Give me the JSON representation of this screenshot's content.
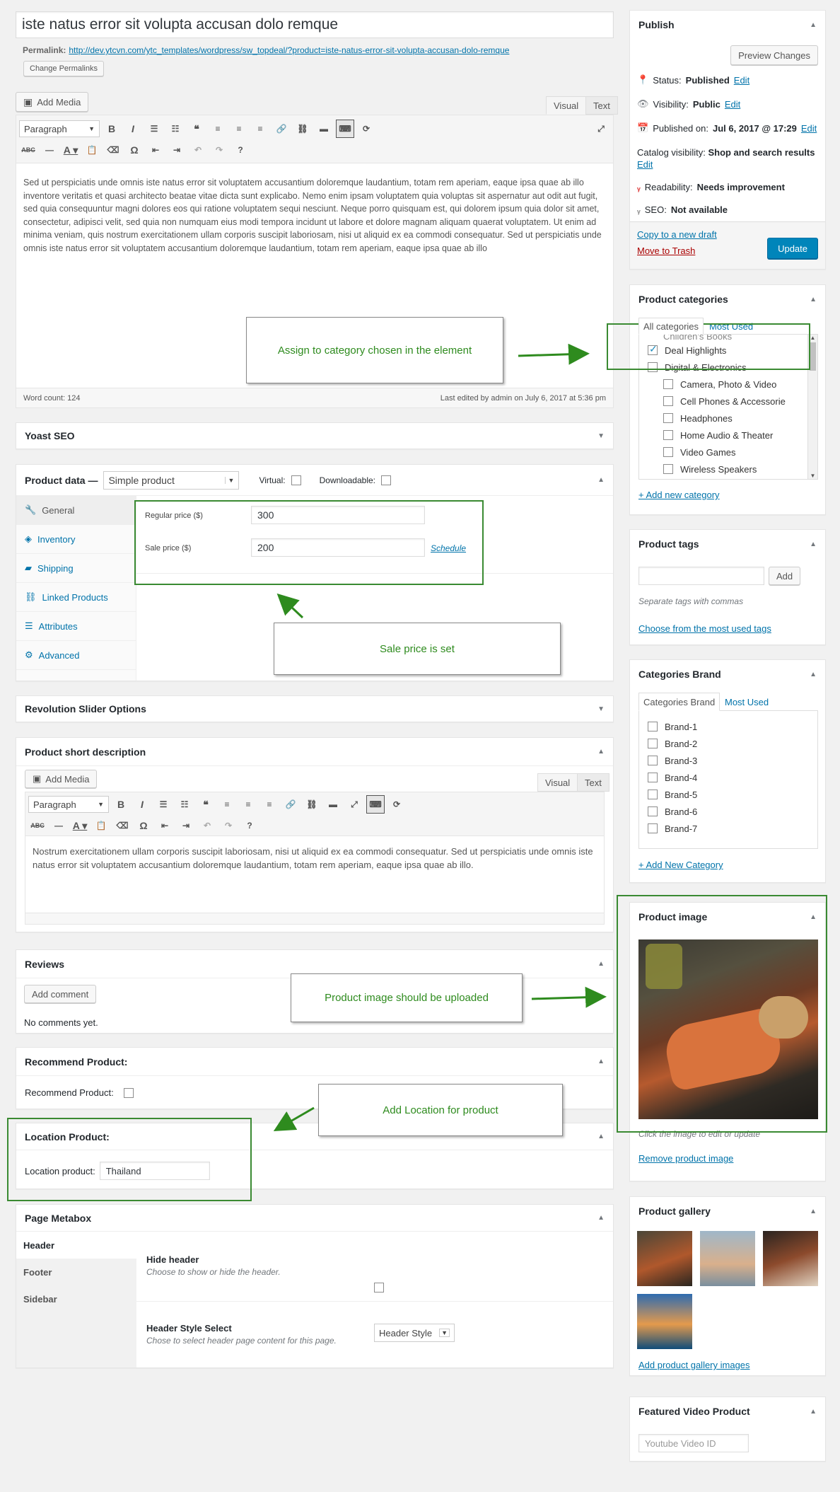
{
  "post": {
    "title": "iste natus error sit volupta accusan dolo remque",
    "permalink_label": "Permalink:",
    "permalink_url": "http://dev.ytcvn.com/ytc_templates/wordpress/sw_topdeal/?product=iste-natus-error-sit-volupta-accusan-dolo-remque",
    "change_permalinks": "Change Permalinks",
    "add_media": "Add Media",
    "tab_visual": "Visual",
    "tab_text": "Text",
    "format": "Paragraph",
    "content": "Sed ut perspiciatis unde omnis iste natus error sit voluptatem accusantium doloremque laudantium, totam rem aperiam, eaque ipsa quae ab illo inventore veritatis et quasi architecto beatae vitae dicta sunt explicabo. Nemo enim ipsam voluptatem quia voluptas sit aspernatur aut odit aut fugit, sed quia consequuntur magni dolores eos qui ratione voluptatem sequi nesciunt. Neque porro quisquam est, qui dolorem ipsum quia dolor sit amet, consectetur, adipisci velit, sed quia non numquam eius modi tempora incidunt ut labore et dolore magnam aliquam quaerat voluptatem. Ut enim ad minima veniam, quis nostrum exercitationem ullam corporis suscipit laboriosam, nisi ut aliquid ex ea commodi consequatur. Sed ut perspiciatis unde omnis iste natus error sit voluptatem accusantium doloremque laudantium, totam rem aperiam, eaque ipsa quae ab illo",
    "word_count": "Word count: 124",
    "last_edited": "Last edited by admin on July 6, 2017 at 5:36 pm"
  },
  "yoast": {
    "title": "Yoast SEO"
  },
  "product_data": {
    "title": "Product data —",
    "type": "Simple product",
    "virtual": "Virtual:",
    "downloadable": "Downloadable:",
    "tabs": [
      {
        "label": "General",
        "icon": "wrench-icon"
      },
      {
        "label": "Inventory",
        "icon": "tag-icon"
      },
      {
        "label": "Shipping",
        "icon": "truck-icon"
      },
      {
        "label": "Linked Products",
        "icon": "link-icon"
      },
      {
        "label": "Attributes",
        "icon": "list-icon"
      },
      {
        "label": "Advanced",
        "icon": "gear-icon"
      }
    ],
    "regular_price_label": "Regular price ($)",
    "regular_price": "300",
    "sale_price_label": "Sale price ($)",
    "sale_price": "200",
    "schedule": "Schedule"
  },
  "rev_slider": {
    "title": "Revolution Slider Options"
  },
  "short_desc": {
    "title": "Product short description",
    "add_media": "Add Media",
    "tab_visual": "Visual",
    "tab_text": "Text",
    "format": "Paragraph",
    "content": "Nostrum exercitationem ullam corporis suscipit laboriosam, nisi ut aliquid ex ea commodi consequatur. Sed ut perspiciatis unde omnis iste natus error sit voluptatem accusantium doloremque laudantium, totam rem aperiam, eaque ipsa quae ab illo."
  },
  "reviews": {
    "title": "Reviews",
    "add_comment": "Add comment",
    "none": "No comments yet."
  },
  "recommend": {
    "title": "Recommend Product:",
    "label": "Recommend Product:"
  },
  "location": {
    "title": "Location Product:",
    "label": "Location product:",
    "value": "Thailand"
  },
  "page_metabox": {
    "title": "Page Metabox",
    "tabs": [
      "Header",
      "Footer",
      "Sidebar"
    ],
    "hide_header_label": "Hide header",
    "hide_header_desc": "Choose to show or hide the header.",
    "header_style_label": "Header Style Select",
    "header_style_desc": "Chose to select header page content for this page.",
    "header_style_value": "Header Style"
  },
  "publish": {
    "title": "Publish",
    "preview": "Preview Changes",
    "status_label": "Status:",
    "status_value": "Published",
    "visibility_label": "Visibility:",
    "visibility_value": "Public",
    "published_on_label": "Published on:",
    "published_on_value": "Jul 6, 2017 @ 17:29",
    "catalog_label": "Catalog visibility:",
    "catalog_value": "Shop and search results",
    "readability_label": "Readability:",
    "readability_value": "Needs improvement",
    "seo_label": "SEO:",
    "seo_value": "Not available",
    "edit": "Edit",
    "copy_draft": "Copy to a new draft",
    "trash": "Move to Trash",
    "update": "Update"
  },
  "categories": {
    "title": "Product categories",
    "tab_all": "All categories",
    "tab_used": "Most Used",
    "partial": "Children's Books",
    "items": [
      {
        "label": "Deal Highlights",
        "checked": true,
        "indent": 0
      },
      {
        "label": "Digital & Electronics",
        "checked": false,
        "indent": 0
      },
      {
        "label": "Camera, Photo & Video",
        "checked": false,
        "indent": 1
      },
      {
        "label": "Cell Phones & Accessorie",
        "checked": false,
        "indent": 1
      },
      {
        "label": "Headphones",
        "checked": false,
        "indent": 1
      },
      {
        "label": "Home Audio & Theater",
        "checked": false,
        "indent": 1
      },
      {
        "label": "Video Games",
        "checked": false,
        "indent": 1
      },
      {
        "label": "Wireless Speakers",
        "checked": false,
        "indent": 1
      }
    ],
    "add_new": "+ Add new category"
  },
  "tags": {
    "title": "Product tags",
    "add": "Add",
    "hint": "Separate tags with commas",
    "choose": "Choose from the most used tags"
  },
  "brands": {
    "title": "Categories Brand",
    "tab_all": "Categories Brand",
    "tab_used": "Most Used",
    "items": [
      "Brand-1",
      "Brand-2",
      "Brand-3",
      "Brand-4",
      "Brand-5",
      "Brand-6",
      "Brand-7"
    ],
    "add_new": "+ Add New Category"
  },
  "product_image": {
    "title": "Product image",
    "hint": "Click the image to edit or update",
    "remove": "Remove product image"
  },
  "gallery": {
    "title": "Product gallery",
    "add": "Add product gallery images"
  },
  "video": {
    "title": "Featured Video Product",
    "placeholder": "Youtube Video ID"
  },
  "annotations": {
    "category": "Assign to category chosen in the element",
    "sale": "Sale price is set",
    "image": "Product image should be uploaded",
    "location": "Add Location for product"
  },
  "colors": {
    "accent": "#0073aa",
    "annotation": "#3a8a32",
    "primary_button": "#0085ba",
    "trash": "#a00"
  }
}
